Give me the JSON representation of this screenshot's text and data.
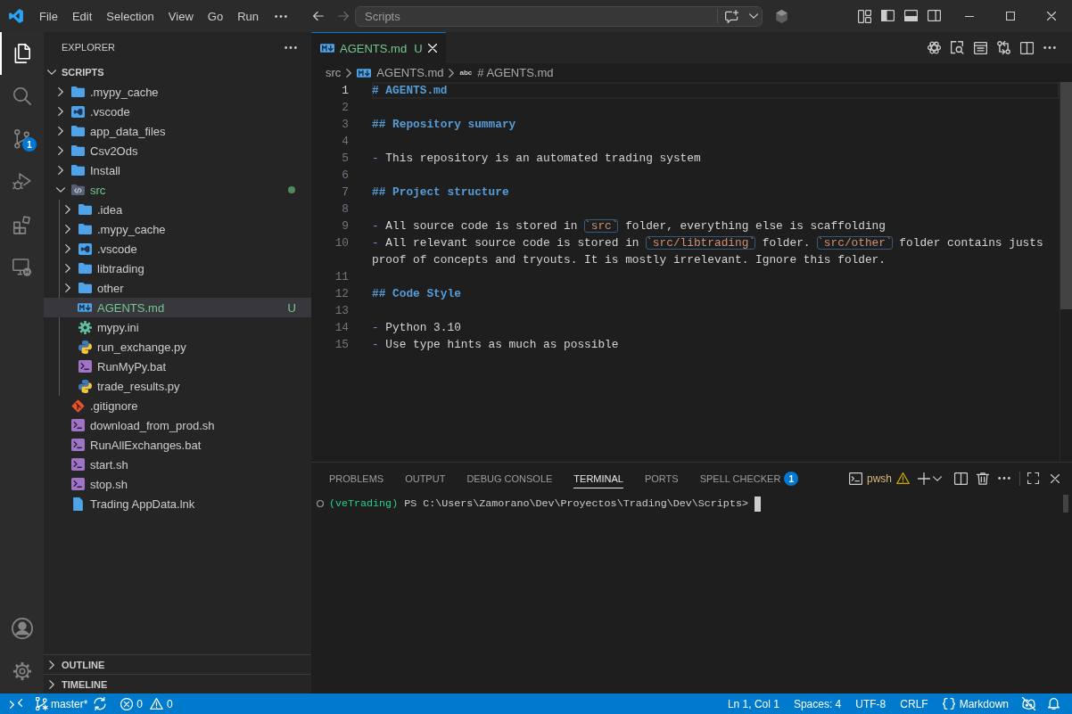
{
  "title_bar": {
    "menu": [
      "File",
      "Edit",
      "Selection",
      "View",
      "Go",
      "Run"
    ],
    "command_center": {
      "label": "Scripts"
    },
    "layout_toggles": [
      {
        "kind": "primary-sidebar",
        "on": true
      },
      {
        "kind": "panel",
        "on": true
      },
      {
        "kind": "secondary-sidebar",
        "on": false
      }
    ]
  },
  "activity_bar": {
    "items": [
      {
        "kind": "explorer",
        "selected": true
      },
      {
        "kind": "search",
        "selected": false
      },
      {
        "kind": "source-control",
        "selected": false,
        "badge": "1"
      },
      {
        "kind": "run-debug",
        "selected": false
      },
      {
        "kind": "extensions",
        "selected": false
      },
      {
        "kind": "remote-explorer",
        "selected": false
      }
    ],
    "bottom_items": [
      {
        "kind": "accounts"
      },
      {
        "kind": "settings"
      }
    ]
  },
  "sidebar": {
    "title": "EXPLORER",
    "folder": {
      "name": "SCRIPTS",
      "expanded": true,
      "children": [
        {
          "name": ".mypy_cache",
          "kind": "folder",
          "expanded": false,
          "selected": false,
          "untracked": false
        },
        {
          "name": ".vscode",
          "kind": "vscode-folder",
          "expanded": false,
          "selected": false,
          "untracked": false
        },
        {
          "name": "app_data_files",
          "kind": "folder",
          "expanded": false,
          "selected": false,
          "untracked": false
        },
        {
          "name": "Csv2Ods",
          "kind": "folder",
          "expanded": false,
          "selected": false,
          "untracked": false
        },
        {
          "name": "Install",
          "kind": "folder",
          "expanded": false,
          "selected": false,
          "untracked": false
        },
        {
          "name": "src",
          "kind": "source-folder",
          "expanded": true,
          "selected": false,
          "untracked": true,
          "children": [
            {
              "name": ".idea",
              "kind": "folder",
              "expanded": false,
              "selected": false,
              "untracked": false
            },
            {
              "name": ".mypy_cache",
              "kind": "folder",
              "expanded": false,
              "selected": false,
              "untracked": false
            },
            {
              "name": ".vscode",
              "kind": "vscode-folder",
              "expanded": false,
              "selected": false,
              "untracked": false
            },
            {
              "name": "libtrading",
              "kind": "folder",
              "expanded": false,
              "selected": false,
              "untracked": false
            },
            {
              "name": "other",
              "kind": "folder",
              "expanded": false,
              "selected": false,
              "untracked": false
            },
            {
              "name": "AGENTS.md",
              "kind": "markdown",
              "selected": true,
              "untracked": true,
              "status": "U"
            },
            {
              "name": "mypy.ini",
              "kind": "config",
              "selected": false,
              "untracked": false
            },
            {
              "name": "run_exchange.py",
              "kind": "python",
              "selected": false,
              "untracked": false
            },
            {
              "name": "RunMyPy.bat",
              "kind": "script",
              "selected": false,
              "untracked": false
            },
            {
              "name": "trade_results.py",
              "kind": "python",
              "selected": false,
              "untracked": false
            }
          ]
        },
        {
          "name": ".gitignore",
          "kind": "git",
          "selected": false,
          "untracked": false
        },
        {
          "name": "download_from_prod.sh",
          "kind": "script",
          "selected": false,
          "untracked": false
        },
        {
          "name": "RunAllExchanges.bat",
          "kind": "script",
          "selected": false,
          "untracked": false
        },
        {
          "name": "start.sh",
          "kind": "script",
          "selected": false,
          "untracked": false
        },
        {
          "name": "stop.sh",
          "kind": "script",
          "selected": false,
          "untracked": false
        },
        {
          "name": "Trading AppData.lnk",
          "kind": "file",
          "selected": false,
          "untracked": false
        }
      ]
    },
    "sections": [
      {
        "title": "OUTLINE",
        "expanded": false
      },
      {
        "title": "TIMELINE",
        "expanded": false
      }
    ]
  },
  "editor": {
    "tabs": [
      {
        "label": "AGENTS.md",
        "kind": "markdown",
        "status": "U",
        "untracked": true,
        "selected": true
      }
    ],
    "breadcrumbs": [
      {
        "label": "src",
        "kind": "folder"
      },
      {
        "label": "AGENTS.md",
        "kind": "markdown"
      },
      {
        "label": "# AGENTS.md",
        "kind": "string",
        "glyph": "abc"
      }
    ],
    "lines": [
      {
        "number": "1",
        "current": true,
        "segments": [
          {
            "kind": "heading",
            "text": "# AGENTS.md"
          }
        ]
      },
      {
        "number": "2",
        "current": false
      },
      {
        "number": "3",
        "current": false,
        "segments": [
          {
            "kind": "heading",
            "text": "## Repository summary"
          }
        ]
      },
      {
        "number": "4",
        "current": false
      },
      {
        "number": "5",
        "current": false,
        "segments": [
          {
            "kind": "bullet",
            "text": "- "
          },
          {
            "kind": "text",
            "text": "This repository is an automated trading system"
          }
        ]
      },
      {
        "number": "6",
        "current": false
      },
      {
        "number": "7",
        "current": false,
        "segments": [
          {
            "kind": "heading",
            "text": "## Project structure"
          }
        ]
      },
      {
        "number": "8",
        "current": false
      },
      {
        "number": "9",
        "current": false,
        "segments": [
          {
            "kind": "bullet",
            "text": "- "
          },
          {
            "kind": "text",
            "text": "All source code is stored in "
          },
          {
            "kind": "code",
            "text": "`src`"
          },
          {
            "kind": "text",
            "text": " folder, everything else is scaffolding"
          }
        ]
      },
      {
        "number": "10",
        "current": false,
        "segments": [
          {
            "kind": "bullet",
            "text": "- "
          },
          {
            "kind": "text",
            "text": "All relevant source code is stored in "
          },
          {
            "kind": "code",
            "text": "`src/libtrading`"
          },
          {
            "kind": "text",
            "text": " folder. "
          },
          {
            "kind": "code",
            "text": "`src/other`"
          },
          {
            "kind": "text",
            "text": " folder contains justs proof of concepts and tryouts. It is mostly irrelevant. Ignore this folder."
          }
        ]
      },
      {
        "number": "11",
        "current": false
      },
      {
        "number": "12",
        "current": false,
        "segments": [
          {
            "kind": "heading",
            "text": "## Code Style"
          }
        ]
      },
      {
        "number": "13",
        "current": false
      },
      {
        "number": "14",
        "current": false,
        "segments": [
          {
            "kind": "bullet",
            "text": "- "
          },
          {
            "kind": "text",
            "text": "Python 3.10"
          }
        ]
      },
      {
        "number": "15",
        "current": false,
        "segments": [
          {
            "kind": "bullet",
            "text": "- "
          },
          {
            "kind": "text",
            "text": "Use type hints as much as possible"
          }
        ]
      }
    ]
  },
  "panel": {
    "tabs": [
      {
        "label": "PROBLEMS",
        "selected": false
      },
      {
        "label": "OUTPUT",
        "selected": false
      },
      {
        "label": "DEBUG CONSOLE",
        "selected": false
      },
      {
        "label": "TERMINAL",
        "selected": true
      },
      {
        "label": "PORTS",
        "selected": false
      },
      {
        "label": "SPELL CHECKER",
        "selected": false,
        "badge": "1"
      }
    ],
    "terminal_tab": {
      "name": "pwsh",
      "warning": true
    },
    "terminal": {
      "env": "(veTrading)",
      "prompt": " PS C:\\Users\\Zamorano\\Dev\\Proyectos\\Trading\\Dev\\Scripts>"
    }
  },
  "status_bar": {
    "branch": "master*",
    "problems": {
      "errors": "0",
      "warnings": "0"
    },
    "items": [
      "Ln 1, Col 1",
      "Spaces: 4",
      "UTF-8",
      "CRLF"
    ],
    "language": "Markdown"
  }
}
